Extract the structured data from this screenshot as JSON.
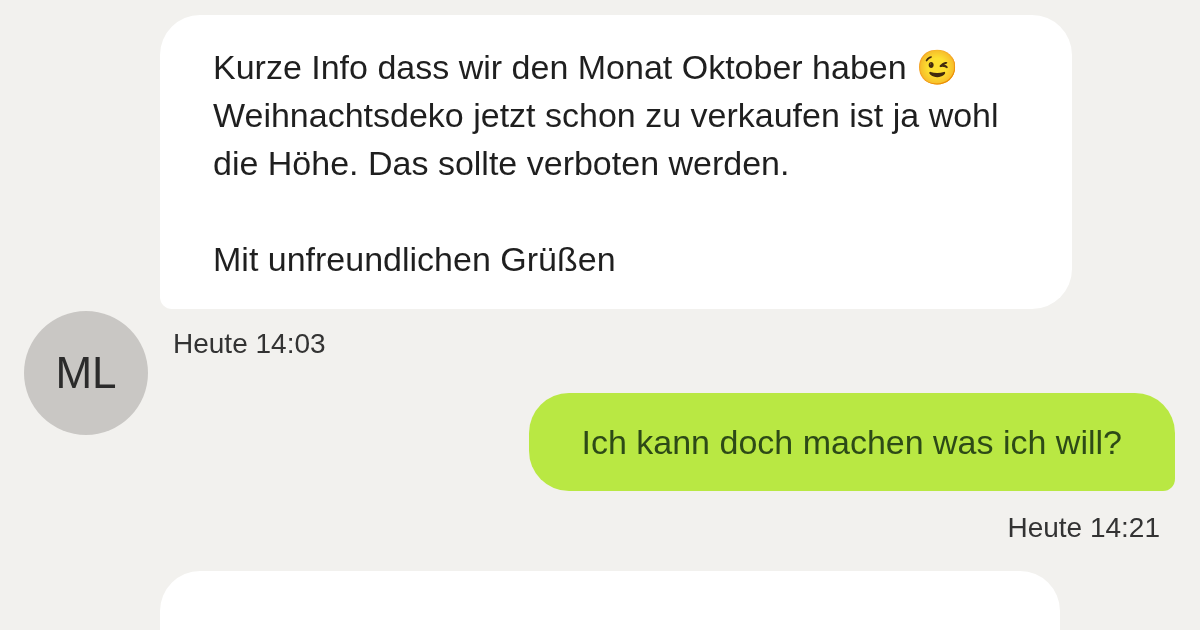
{
  "messages": [
    {
      "kind": "incoming",
      "avatar": "ML",
      "text": "Kurze Info dass wir den Monat Oktober haben 😉 Weihnachtsdeko jetzt schon zu verkaufen ist ja wohl die Höhe. Das sollte verboten werden.\n\nMit unfreundlichen Grüßen",
      "time": "Heute 14:03"
    },
    {
      "kind": "outgoing",
      "text": "Ich kann doch machen was ich will?",
      "time": "Heute 14:21"
    },
    {
      "kind": "incoming_partial"
    }
  ]
}
